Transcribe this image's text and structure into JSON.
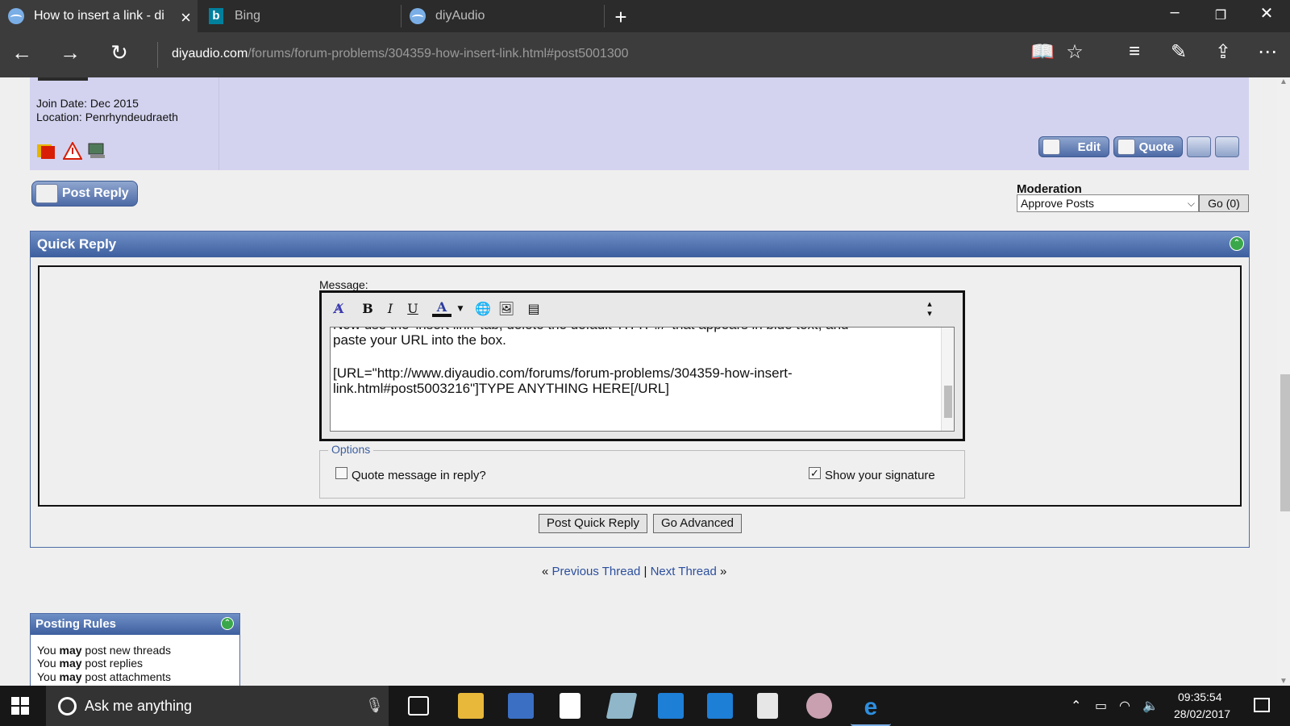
{
  "tabs": [
    {
      "label": "How to insert a link - di",
      "active": true
    },
    {
      "label": "Bing",
      "active": false
    },
    {
      "label": "diyAudio",
      "active": false
    }
  ],
  "address": {
    "host": "diyaudio.com",
    "path": "/forums/forum-problems/304359-how-insert-link.html#post5001300"
  },
  "user": {
    "join_date": "Join Date: Dec 2015",
    "location": "Location: Penrhyndeudraeth"
  },
  "post_buttons": {
    "edit": "Edit",
    "quote": "Quote"
  },
  "post_reply": "Post Reply",
  "moderation": {
    "label": "Moderation",
    "selected": "Approve Posts",
    "go": "Go (0)"
  },
  "quick_reply": {
    "title": "Quick Reply",
    "message_label": "Message:",
    "text_line0": "Now use the 'insert link' tab, delete the default 'HTTP://' that appears in blue text, and",
    "text_line1": "paste your URL into the box.",
    "text_line2": "[URL=\"http://www.diyaudio.com/forums/forum-problems/304359-how-insert-",
    "text_line3": "link.html#post5003216\"]TYPE ANYTHING HERE[/URL]",
    "options_legend": "Options",
    "quote_option": "Quote message in reply?",
    "signature_option": "Show your signature",
    "quote_checked": false,
    "signature_checked": true,
    "post_button": "Post Quick Reply",
    "advanced_button": "Go Advanced"
  },
  "thread_nav": {
    "prev": "Previous Thread",
    "next": "Next Thread",
    "sep": "|",
    "left": "«",
    "right": "»"
  },
  "posting_rules": {
    "title": "Posting Rules",
    "rules": [
      {
        "pre": "You ",
        "bold": "may",
        "post": " post new threads"
      },
      {
        "pre": "You ",
        "bold": "may",
        "post": " post replies"
      },
      {
        "pre": "You ",
        "bold": "may",
        "post": " post attachments"
      }
    ]
  },
  "taskbar": {
    "search_placeholder": "Ask me anything",
    "time": "09:35:54",
    "date": "28/02/2017"
  },
  "colors": {
    "header_blue": "#3d5f9e",
    "post_bg": "#d3d3ef",
    "link": "#2b4f9e"
  }
}
